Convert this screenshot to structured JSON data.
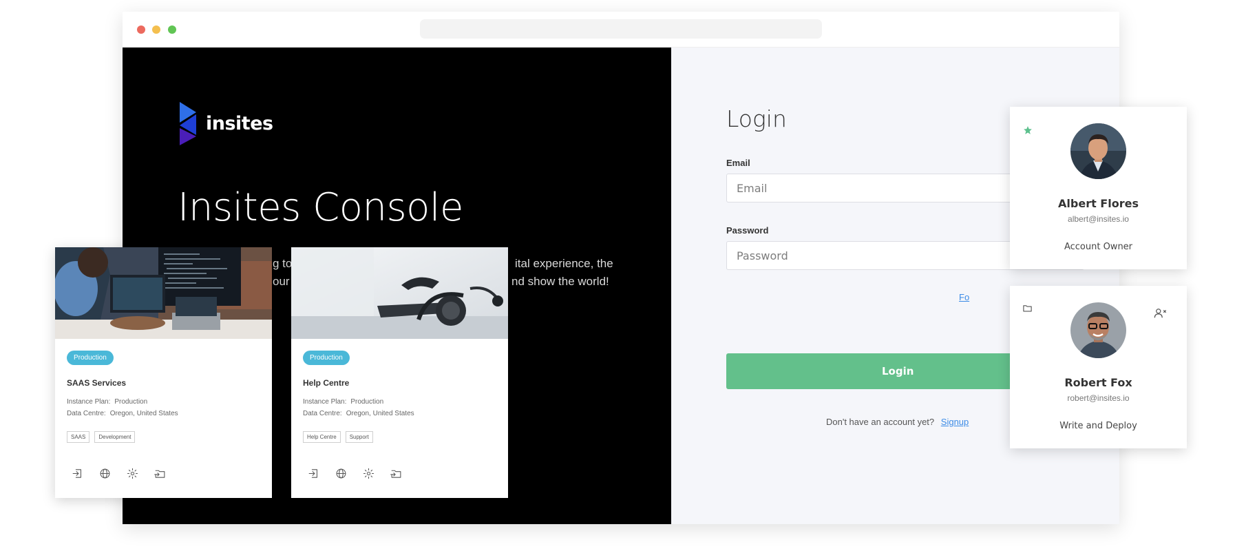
{
  "brand": {
    "name": "insites",
    "console_title": "Insites Console",
    "intro_lines": [
      "g to",
      "ital experience, the",
      "our",
      "nd show the world!"
    ]
  },
  "login": {
    "title": "Login",
    "email_label": "Email",
    "email_placeholder": "Email",
    "email_value": "",
    "password_label": "Password",
    "password_placeholder": "Password",
    "password_value": "",
    "forgot_text": "Fo",
    "button_label": "Login",
    "signup_prompt": "Don't have an account yet?",
    "signup_link": "Signup"
  },
  "instances": [
    {
      "badge": "Production",
      "title": "SAAS Services",
      "plan_label": "Instance Plan:",
      "plan_value": "Production",
      "datacentre_label": "Data Centre:",
      "datacentre_value": "Oregon, United States",
      "tags": [
        "SAAS",
        "Development"
      ],
      "actions": [
        "login-icon",
        "globe-icon",
        "settings-icon",
        "folder-import-icon"
      ]
    },
    {
      "badge": "Production",
      "title": "Help Centre",
      "plan_label": "Instance Plan:",
      "plan_value": "Production",
      "datacentre_label": "Data Centre:",
      "datacentre_value": "Oregon, United States",
      "tags": [
        "Help Centre",
        "Support"
      ],
      "actions": [
        "login-icon",
        "globe-icon",
        "settings-icon",
        "folder-import-icon"
      ]
    }
  ],
  "profiles": [
    {
      "name": "Albert Flores",
      "email": "albert@insites.io",
      "role": "Account Owner",
      "corner_icon": "star-icon"
    },
    {
      "name": "Robert Fox",
      "email": "robert@insites.io",
      "role": "Write and Deploy",
      "corner_icon": "folder-icon",
      "right_icon": "remove-user-icon"
    }
  ],
  "colors": {
    "login_button": "#63c08b",
    "badge": "#4ab8d8",
    "link": "#3b8be6",
    "star": "#5cc08d",
    "left_panel": "#000000",
    "right_panel": "#f5f6fa"
  }
}
